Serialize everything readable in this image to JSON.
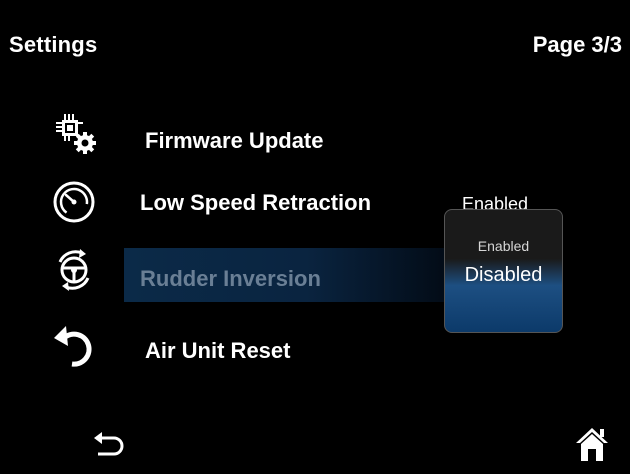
{
  "header": {
    "title": "Settings",
    "page": "Page 3/3"
  },
  "menu": {
    "items": [
      {
        "label": "Firmware Update",
        "icon": "firmware-chip-gear-icon"
      },
      {
        "label": "Low Speed Retraction",
        "value": "Enabled",
        "icon": "speedometer-icon"
      },
      {
        "label": "Rudder Inversion",
        "icon": "steering-wheel-rotate-icon",
        "selected": true
      },
      {
        "label": "Air Unit Reset",
        "icon": "reset-arrow-icon"
      }
    ]
  },
  "dropdown": {
    "options": [
      "Enabled",
      "Disabled"
    ],
    "selected": "Disabled"
  },
  "footer": {
    "back_icon": "back-arrow-icon",
    "home_icon": "home-icon"
  },
  "colors": {
    "highlight": "#0b2a48",
    "dropdown_selected": "#1d4f82",
    "dimmed_label": "#6a7f95"
  }
}
